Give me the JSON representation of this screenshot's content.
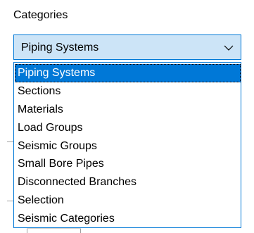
{
  "categories_label": "Categories",
  "combo": {
    "selected_value": "Piping Systems",
    "arrow_icon": "chevron-down-icon"
  },
  "dropdown": {
    "items": [
      {
        "label": "Piping Systems",
        "selected": true
      },
      {
        "label": "Sections",
        "selected": false
      },
      {
        "label": "Materials",
        "selected": false
      },
      {
        "label": "Load Groups",
        "selected": false
      },
      {
        "label": "Seismic Groups",
        "selected": false
      },
      {
        "label": "Small Bore Pipes",
        "selected": false
      },
      {
        "label": "Disconnected Branches",
        "selected": false
      },
      {
        "label": "Selection",
        "selected": false
      },
      {
        "label": "Seismic Categories",
        "selected": false
      }
    ]
  },
  "colors": {
    "accent": "#0078d7",
    "combo_background": "#cce4f7",
    "panel_background": "#ffffff"
  }
}
